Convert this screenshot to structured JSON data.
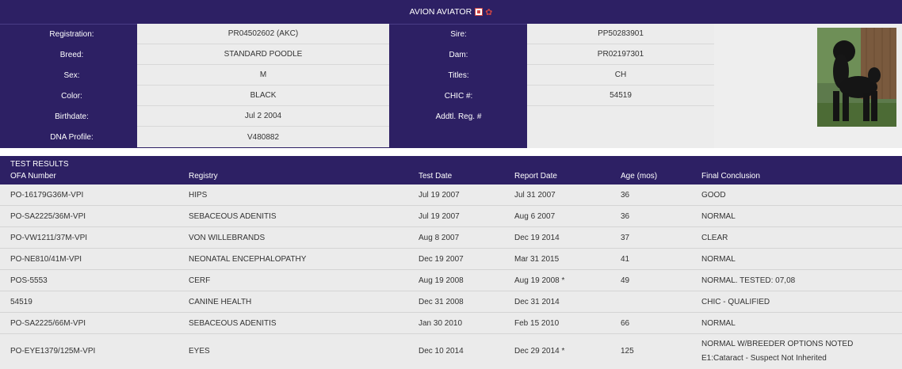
{
  "header": {
    "title": "AVION AVIATOR"
  },
  "details_left": [
    {
      "label": "Registration:",
      "value": "PR04502602 (AKC)"
    },
    {
      "label": "Breed:",
      "value": "STANDARD POODLE"
    },
    {
      "label": "Sex:",
      "value": "M"
    },
    {
      "label": "Color:",
      "value": "BLACK"
    },
    {
      "label": "Birthdate:",
      "value": "Jul 2 2004"
    },
    {
      "label": "DNA Profile:",
      "value": "V480882"
    }
  ],
  "details_right": [
    {
      "label": "Sire:",
      "value": "PP50283901"
    },
    {
      "label": "Dam:",
      "value": "PR02197301"
    },
    {
      "label": "Titles:",
      "value": "CH"
    },
    {
      "label": "CHIC #:",
      "value": "54519"
    },
    {
      "label": "Addtl. Reg. #",
      "value": ""
    }
  ],
  "results": {
    "title": "TEST RESULTS",
    "columns": [
      "OFA Number",
      "Registry",
      "Test Date",
      "Report Date",
      "Age (mos)",
      "Final Conclusion"
    ],
    "rows": [
      [
        "PO-16179G36M-VPI",
        "HIPS",
        "Jul 19 2007",
        "Jul 31 2007",
        "36",
        "GOOD",
        ""
      ],
      [
        "PO-SA2225/36M-VPI",
        "SEBACEOUS ADENITIS",
        "Jul 19 2007",
        "Aug 6 2007",
        "36",
        "NORMAL",
        ""
      ],
      [
        "PO-VW1211/37M-VPI",
        "VON WILLEBRANDS",
        "Aug 8 2007",
        "Dec 19 2014",
        "37",
        "CLEAR",
        ""
      ],
      [
        "PO-NE810/41M-VPI",
        "NEONATAL ENCEPHALOPATHY",
        "Dec 19 2007",
        "Mar 31 2015",
        "41",
        "NORMAL",
        ""
      ],
      [
        "POS-5553",
        "CERF",
        "Aug 19 2008",
        "Aug 19 2008 *",
        "49",
        "NORMAL. TESTED: 07,08",
        ""
      ],
      [
        "54519",
        "CANINE HEALTH",
        "Dec 31 2008",
        "Dec 31 2014",
        "",
        "CHIC - QUALIFIED",
        ""
      ],
      [
        "PO-SA2225/66M-VPI",
        "SEBACEOUS ADENITIS",
        "Jan 30 2010",
        "Feb 15 2010",
        "66",
        "NORMAL",
        ""
      ],
      [
        "PO-EYE1379/125M-VPI",
        "EYES",
        "Dec 10 2014",
        "Dec 29 2014 *",
        "125",
        "NORMAL W/BREEDER OPTIONS NOTED",
        "E1:Cataract - Suspect Not Inherited"
      ]
    ]
  }
}
